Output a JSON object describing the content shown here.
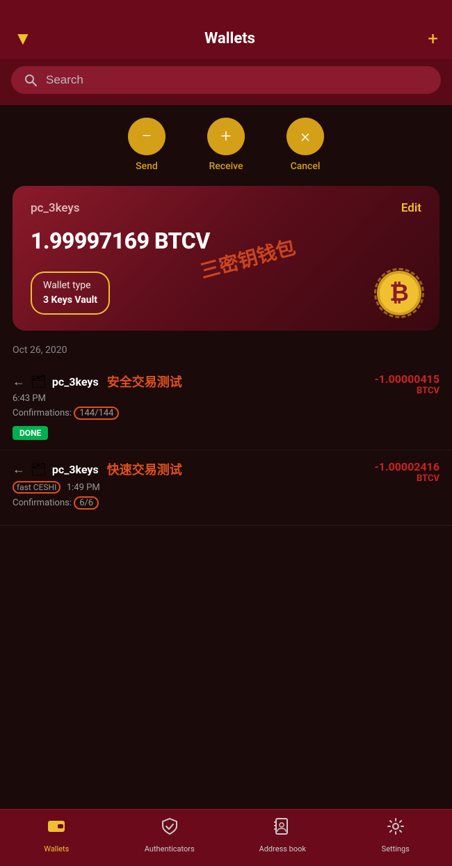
{
  "header": {
    "title": "Wallets",
    "filter_icon": "▼",
    "add_icon": "+"
  },
  "search": {
    "placeholder": "Search"
  },
  "actions": [
    {
      "icon": "−",
      "label": "Send"
    },
    {
      "icon": "+",
      "label": "Receive"
    },
    {
      "icon": "×",
      "label": "Cancel"
    }
  ],
  "wallet_card": {
    "name": "pc_3keys",
    "edit_label": "Edit",
    "balance": "1.99997169 BTCV",
    "wallet_type_label": "Wallet type",
    "wallet_type_value": "3 Keys Vault",
    "watermark": "三密钥钱包",
    "btc_symbol": "₿"
  },
  "date_section": {
    "label": "Oct 26, 2020"
  },
  "transactions": [
    {
      "direction": "←",
      "wallet_icon": "🗂",
      "wallet_name": "pc_3keys",
      "label_cn": "安全交易测试",
      "time": "6:43 PM",
      "confirmations": "Confirmations: 144/144",
      "conf_highlight": "144/144",
      "badge": "DONE",
      "amount": "-1.00000415",
      "currency": "BTCV",
      "fast_label": null
    },
    {
      "direction": "←",
      "wallet_icon": "🗂",
      "wallet_name": "pc_3keys",
      "label_cn": "快速交易测试",
      "time": "1:49 PM",
      "confirmations": "Confirmations: 6/6",
      "conf_highlight": "6/6",
      "badge": null,
      "amount": "-1.00002416",
      "currency": "BTCV",
      "fast_label": "fast CESHI"
    }
  ],
  "bottom_nav": [
    {
      "id": "wallets",
      "icon": "▤",
      "label": "Wallets",
      "active": true
    },
    {
      "id": "authenticators",
      "icon": "🛡",
      "label": "Authenticators",
      "active": false
    },
    {
      "id": "address-book",
      "icon": "👤",
      "label": "Address book",
      "active": false
    },
    {
      "id": "settings",
      "icon": "⚙",
      "label": "Settings",
      "active": false
    }
  ]
}
